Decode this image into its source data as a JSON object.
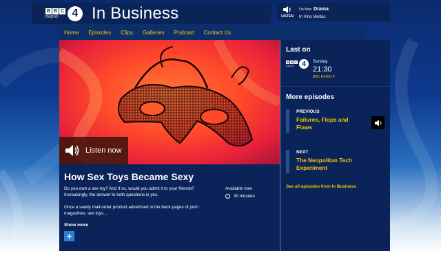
{
  "header": {
    "bbc_letters": [
      "B",
      "B",
      "C"
    ],
    "radio_label": "RADIO",
    "station_number": "4",
    "title": "In Business"
  },
  "on_now": {
    "listen_label": "LISTEN",
    "label": "On Now",
    "genre": "Drama",
    "programme": "In Vino Veritas"
  },
  "nav": {
    "items": [
      "Home",
      "Episodes",
      "Clips",
      "Galleries",
      "Podcast",
      "Contact Us"
    ]
  },
  "episode": {
    "listen_now": "Listen now",
    "title": "How Sex Toys Became Sexy",
    "description": [
      "Do you own a sex toy? And if so, would you admit it to your friends? Increasingly, the answer to both questions is yes.",
      "Once a seedy mail-order product advertised in the back pages of porn magazines, sex toys..."
    ],
    "available": "Available now",
    "duration": "30 minutes",
    "show_more": "Show more",
    "plus": "+"
  },
  "last_on": {
    "heading": "Last on",
    "day": "Sunday",
    "time": "21:30",
    "station": "BBC RADIO 4"
  },
  "more_episodes": {
    "heading": "More episodes",
    "previous": {
      "kind": "PREVIOUS",
      "title": "Failures, Flops and Flaws"
    },
    "next": {
      "kind": "NEXT",
      "title": "The Neopolitan Tech Experiment"
    },
    "see_all": "See all episodes from In Business"
  },
  "colors": {
    "accent": "#f5c400",
    "panel": "#0a245a",
    "header": "#0b2458",
    "plus_button": "#2f7fd0"
  },
  "icons": [
    "speaker-icon",
    "clock-icon",
    "plus-icon",
    "bbc-radio4-logo"
  ]
}
